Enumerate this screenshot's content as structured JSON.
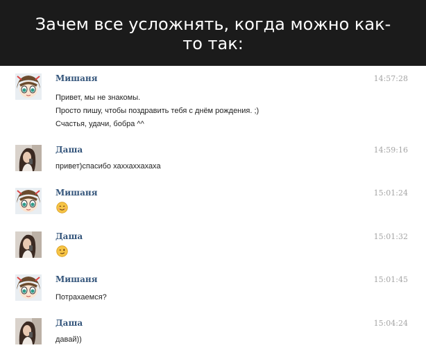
{
  "meme_caption": {
    "line1": "Зачем все усложнять, когда можно как-",
    "line2": "то так:"
  },
  "chat": {
    "messages": [
      {
        "author": "Мишаня",
        "time": "14:57:28",
        "lines": [
          "Привет, мы не знакомы.",
          "Просто пишу, чтобы поздравить тебя с днём рождения. ;)",
          "Счастья, удачи, бобра ^^"
        ]
      },
      {
        "author": "Даша",
        "time": "14:59:16",
        "lines": [
          "привет)спасибо хаххаххахаха"
        ]
      },
      {
        "author": "Мишаня",
        "time": "15:01:24",
        "emoji": "smile-emoji"
      },
      {
        "author": "Даша",
        "time": "15:01:32",
        "emoji": "wink-emoji"
      },
      {
        "author": "Мишаня",
        "time": "15:01:45",
        "lines": [
          "Потрахаемся?"
        ]
      },
      {
        "author": "Даша",
        "time": "15:04:24",
        "lines": [
          "давай))"
        ]
      }
    ]
  },
  "colors": {
    "caption_bg": "#1b1b1b",
    "author_link": "#34557b",
    "timestamp": "#a4a4a4",
    "emoji_face": "#f6c445"
  }
}
